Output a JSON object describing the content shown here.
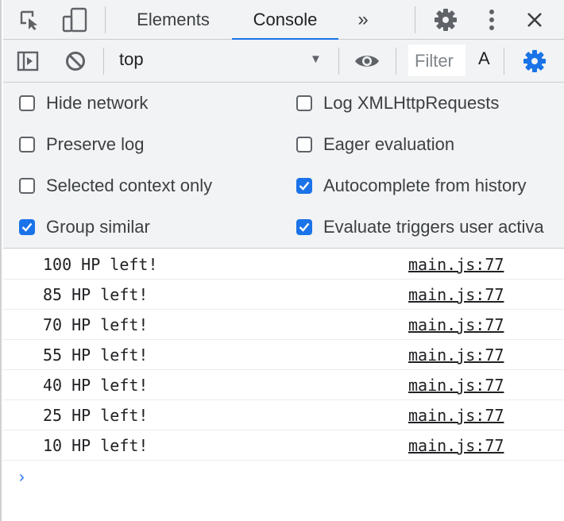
{
  "tabs": [
    {
      "label": "Elements",
      "active": false
    },
    {
      "label": "Console",
      "active": true
    }
  ],
  "tabbar_icons": [
    "inspect-element-icon",
    "device-toggle-icon",
    "more-tabs-icon",
    "gear-icon",
    "kebab-menu-icon",
    "close-icon"
  ],
  "more_tabs_glyph": "»",
  "toolbar": {
    "context": "top",
    "filter_placeholder": "Filter",
    "a_label": "A",
    "icons": [
      "sidebar-toggle-icon",
      "clear-console-icon",
      "dropdown-arrow-icon",
      "eye-icon",
      "gear-icon"
    ]
  },
  "settings": {
    "left": [
      {
        "label": "Hide network",
        "checked": false
      },
      {
        "label": "Preserve log",
        "checked": false
      },
      {
        "label": "Selected context only",
        "checked": false
      },
      {
        "label": "Group similar",
        "checked": true
      }
    ],
    "right": [
      {
        "label": "Log XMLHttpRequests",
        "checked": false
      },
      {
        "label": "Eager evaluation",
        "checked": false
      },
      {
        "label": "Autocomplete from history",
        "checked": true
      },
      {
        "label": "Evaluate triggers user activa",
        "checked": true
      }
    ]
  },
  "console": {
    "messages": [
      {
        "text": "100 HP left!",
        "source": "main.js:77"
      },
      {
        "text": "85 HP left!",
        "source": "main.js:77"
      },
      {
        "text": "70 HP left!",
        "source": "main.js:77"
      },
      {
        "text": "55 HP left!",
        "source": "main.js:77"
      },
      {
        "text": "40 HP left!",
        "source": "main.js:77"
      },
      {
        "text": "25 HP left!",
        "source": "main.js:77"
      },
      {
        "text": "10 HP left!",
        "source": "main.js:77"
      }
    ],
    "prompt_glyph": "›"
  },
  "colors": {
    "accent": "#1a73e8",
    "toolbar_bg": "#f1f3f4",
    "icon": "#5f6368"
  }
}
